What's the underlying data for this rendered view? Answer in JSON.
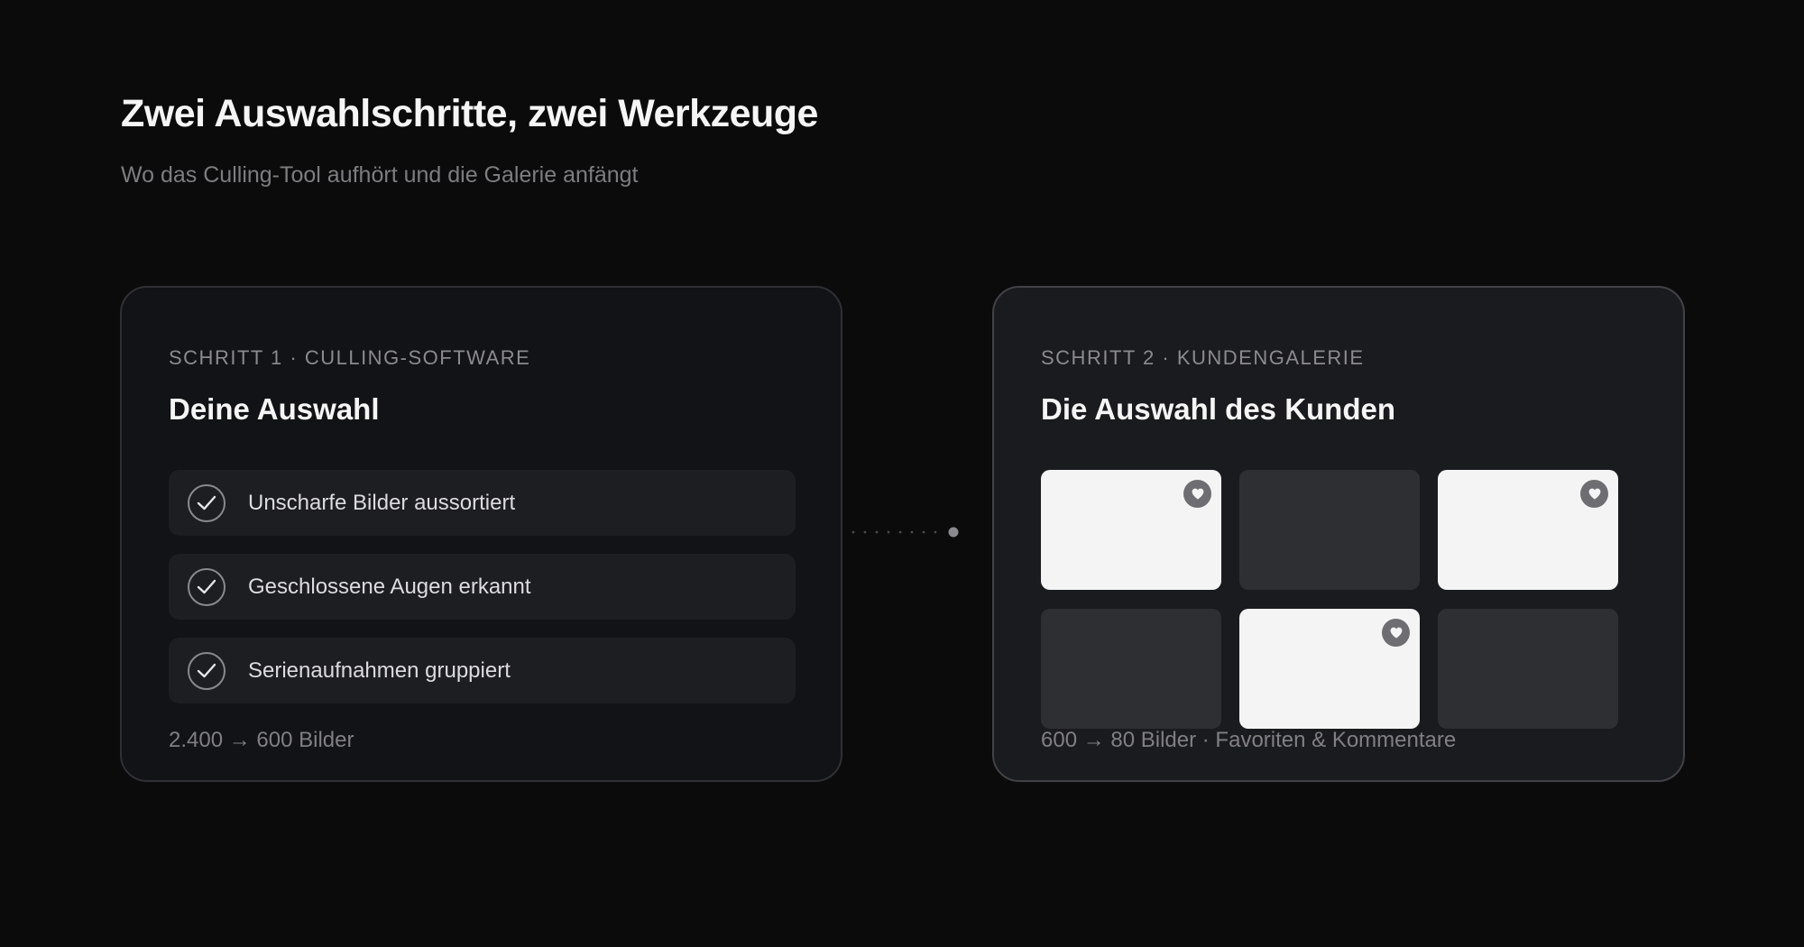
{
  "header": {
    "title": "Zwei Auswahlschritte, zwei Werkzeuge",
    "subtitle": "Wo das Culling-Tool aufhört und die Galerie anfängt"
  },
  "step1": {
    "label": "SCHRITT 1 · CULLING-SOFTWARE",
    "title": "Deine Auswahl",
    "items": [
      {
        "label": "Unscharfe Bilder aussortiert",
        "icon": "check-circle-icon"
      },
      {
        "label": "Geschlossene Augen erkannt",
        "icon": "check-circle-icon"
      },
      {
        "label": "Serienaufnahmen gruppiert",
        "icon": "check-circle-icon"
      }
    ],
    "footer": "2.400 → 600 Bilder"
  },
  "step2": {
    "label": "SCHRITT 2 · KUNDENGALERIE",
    "title": "Die Auswahl des Kunden",
    "tiles": [
      {
        "favorite": true
      },
      {
        "favorite": false
      },
      {
        "favorite": true
      },
      {
        "favorite": false
      },
      {
        "favorite": true
      },
      {
        "favorite": false
      }
    ],
    "footer": "600 → 80 Bilder · Favoriten & Kommentare"
  },
  "colors": {
    "background": "#0b0b0c",
    "card_1": "#121316",
    "card_2": "#1a1b1e",
    "text_primary": "#f5f5f5",
    "text_muted": "#808084",
    "tile_selected": "#f4f4f4",
    "tile_unselected": "#2e2f33"
  }
}
